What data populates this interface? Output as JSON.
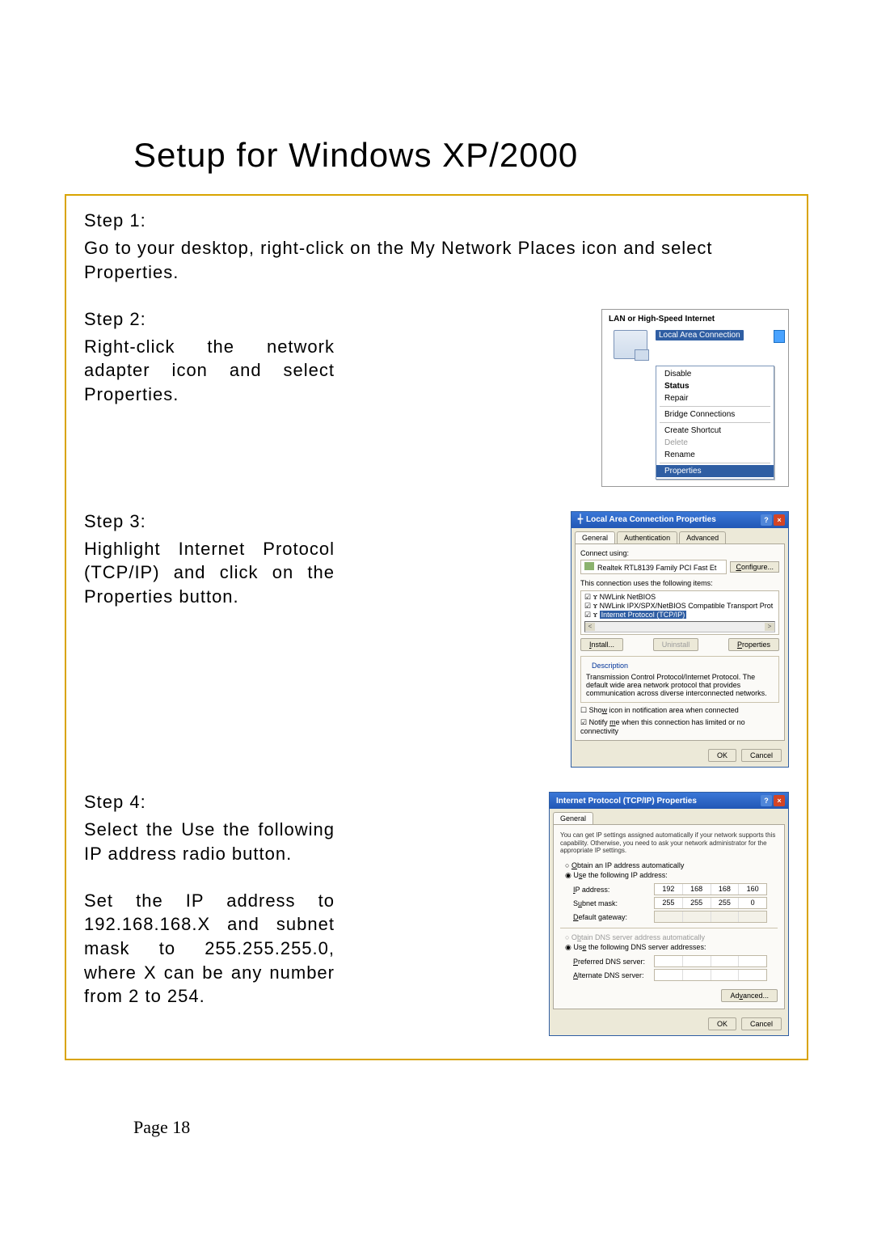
{
  "page_title": "Setup for Windows XP/2000",
  "page_number": "Page 18",
  "steps": {
    "s1": {
      "label": "Step 1:",
      "text": "Go to your desktop, right-click on the My Network Places icon and select Properties."
    },
    "s2": {
      "label": "Step 2:",
      "text": "Right-click the network adapter icon and select Properties."
    },
    "s3": {
      "label": "Step 3:",
      "text": "Highlight Internet Protocol (TCP/IP) and click on the Properties button."
    },
    "s4a": {
      "label": "Step 4:",
      "text": "Select the Use the following IP address radio button."
    },
    "s4b": "Set the IP address to 192.168.168.X and subnet mask to 255.255.255.0, where X can be any number from 2 to 254."
  },
  "scr1": {
    "group_title": "LAN or High-Speed Internet",
    "nic_title": "Local Area Connection",
    "menu": {
      "disable": "Disable",
      "status": "Status",
      "repair": "Repair",
      "bridge": "Bridge Connections",
      "shortcut": "Create Shortcut",
      "delete": "Delete",
      "rename": "Rename",
      "properties": "Properties"
    }
  },
  "scr2": {
    "title": "Local Area Connection Properties",
    "tabs": {
      "general": "General",
      "auth": "Authentication",
      "advanced": "Advanced"
    },
    "connect_using": "Connect using:",
    "adapter": "Realtek RTL8139 Family PCI Fast Et",
    "configure": "Configure...",
    "uses_items": "This connection uses the following items:",
    "items": {
      "a": "NWLink NetBIOS",
      "b": "NWLink IPX/SPX/NetBIOS Compatible Transport Prot",
      "c": "Internet Protocol (TCP/IP)"
    },
    "btns": {
      "install": "Install...",
      "uninstall": "Uninstall",
      "properties": "Properties"
    },
    "desc_label": "Description",
    "desc_text": "Transmission Control Protocol/Internet Protocol. The default wide area network protocol that provides communication across diverse interconnected networks.",
    "show_icon": "Show icon in notification area when connected",
    "notify": "Notify me when this connection has limited or no connectivity",
    "ok": "OK",
    "cancel": "Cancel"
  },
  "scr3": {
    "title": "Internet Protocol (TCP/IP) Properties",
    "tab": "General",
    "help": "You can get IP settings assigned automatically if your network supports this capability. Otherwise, you need to ask your network administrator for the appropriate IP settings.",
    "r_auto_ip": "Obtain an IP address automatically",
    "r_use_ip": "Use the following IP address:",
    "f_ip": "IP address:",
    "f_mask": "Subnet mask:",
    "f_gw": "Default gateway:",
    "ip": {
      "a": "192",
      "b": "168",
      "c": "168",
      "d": "160"
    },
    "mask": {
      "a": "255",
      "b": "255",
      "c": "255",
      "d": "0"
    },
    "r_auto_dns": "Obtain DNS server address automatically",
    "r_use_dns": "Use the following DNS server addresses:",
    "f_pdns": "Preferred DNS server:",
    "f_adns": "Alternate DNS server:",
    "advanced": "Advanced...",
    "ok": "OK",
    "cancel": "Cancel"
  }
}
